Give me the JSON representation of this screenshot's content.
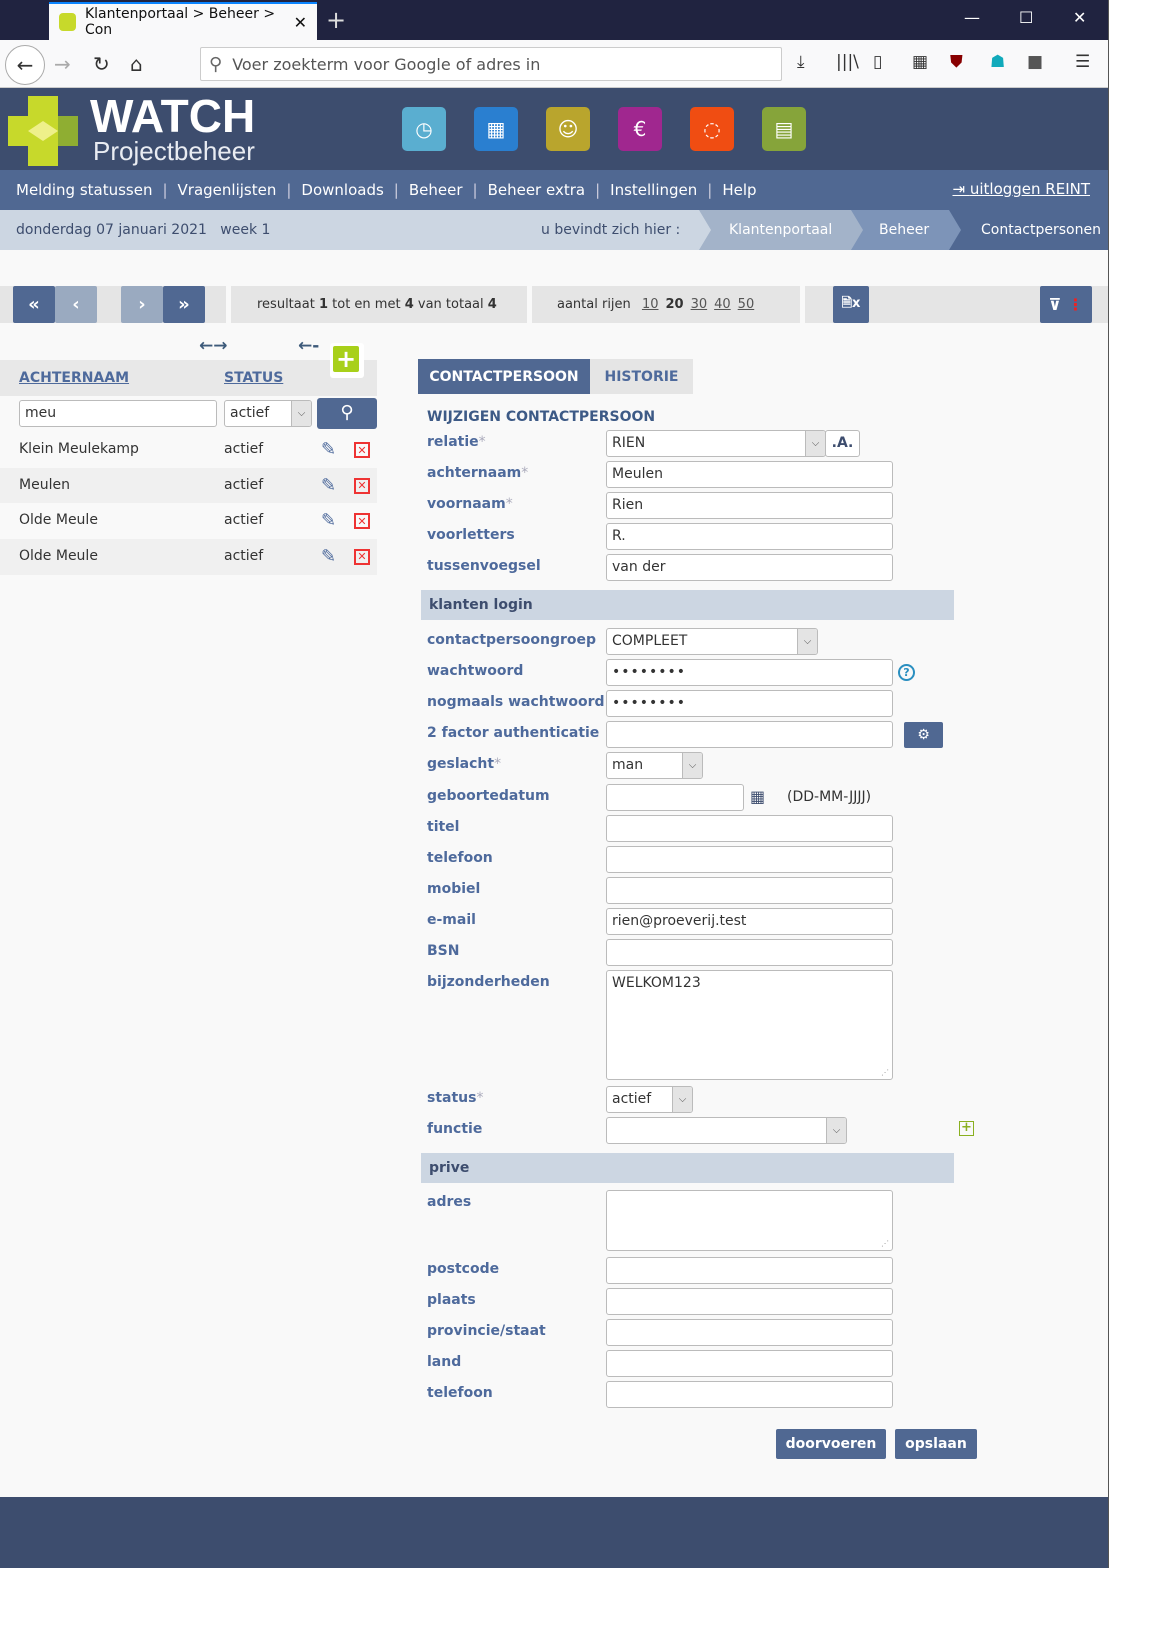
{
  "browser": {
    "tab_title": "Klantenportaal > Beheer > Con",
    "url_placeholder": "Voer zoekterm voor Google of adres in"
  },
  "brand": {
    "name": "WATCH",
    "subtitle": "Projectbeheer",
    "accent": "#c7d92b"
  },
  "app_icons": [
    {
      "name": "clock-icon",
      "color": "#5aaed0"
    },
    {
      "name": "calendar-icon",
      "color": "#2a7fd0"
    },
    {
      "name": "people-icon",
      "color": "#b9a52d"
    },
    {
      "name": "invoice-icon",
      "color": "#a0278f"
    },
    {
      "name": "chat-icon",
      "color": "#f04d12"
    },
    {
      "name": "calculator-icon",
      "color": "#86a43a"
    }
  ],
  "menu": {
    "items": [
      "Melding statussen",
      "Vragenlijsten",
      "Downloads",
      "Beheer",
      "Beheer extra",
      "Instellingen",
      "Help"
    ],
    "logout": "uitloggen REINT"
  },
  "breadcrumb": {
    "date": "donderdag 07 januari 2021",
    "week": "week 1",
    "here_label": "u bevindt zich hier :",
    "items": [
      "Klantenportaal",
      "Beheer",
      "Contactpersonen"
    ]
  },
  "pager": {
    "result_prefix": "resultaat",
    "from": "1",
    "to_label": "tot en met",
    "to": "4",
    "total_label": "van totaal",
    "total": "4",
    "rows_label": "aantal rijen",
    "row_options": [
      "10",
      "20",
      "30",
      "40",
      "50"
    ],
    "rows_selected": "20"
  },
  "list": {
    "col_name": "ACHTERNAAM",
    "col_status": "STATUS",
    "filter_name": "meu",
    "filter_status": "actief",
    "rows": [
      {
        "name": "Klein Meulekamp",
        "status": "actief"
      },
      {
        "name": "Meulen",
        "status": "actief"
      },
      {
        "name": "Olde Meule",
        "status": "actief"
      },
      {
        "name": "Olde Meule",
        "status": "actief"
      }
    ]
  },
  "form": {
    "tabs": [
      "CONTACTPERSOON",
      "HISTORIE"
    ],
    "title": "WIJZIGEN CONTACTPERSOON",
    "relatie_button": ".A.",
    "date_hint": "(DD-MM-JJJJ)",
    "fields": [
      {
        "label": "relatie",
        "required": true,
        "type": "select",
        "value": "RIEN"
      },
      {
        "label": "achternaam",
        "required": true,
        "type": "text",
        "value": "Meulen"
      },
      {
        "label": "voornaam",
        "required": true,
        "type": "text",
        "value": "Rien"
      },
      {
        "label": "voorletters",
        "type": "text",
        "value": "R."
      },
      {
        "label": "tussenvoegsel",
        "type": "text",
        "value": "van der"
      },
      {
        "section": "klanten login"
      },
      {
        "label": "contactpersoongroep",
        "type": "select",
        "value": "COMPLEET"
      },
      {
        "label": "wachtwoord",
        "type": "password",
        "value": "••••••••"
      },
      {
        "label": "nogmaals wachtwoord",
        "type": "password",
        "value": "••••••••"
      },
      {
        "label": "2 factor authenticatie",
        "type": "text",
        "value": ""
      },
      {
        "label": "geslacht",
        "required": true,
        "type": "select",
        "value": "man"
      },
      {
        "label": "geboortedatum",
        "type": "date",
        "value": ""
      },
      {
        "label": "titel",
        "type": "text",
        "value": ""
      },
      {
        "label": "telefoon",
        "type": "text",
        "value": ""
      },
      {
        "label": "mobiel",
        "type": "text",
        "value": ""
      },
      {
        "label": "e-mail",
        "type": "text",
        "value": "rien@proeverij.test"
      },
      {
        "label": "BSN",
        "type": "text",
        "value": ""
      },
      {
        "label": "bijzonderheden",
        "type": "textarea",
        "value": "WELKOM123"
      },
      {
        "label": "status",
        "required": true,
        "type": "select",
        "value": "actief"
      },
      {
        "label": "functie",
        "type": "select",
        "value": ""
      },
      {
        "section": "prive"
      },
      {
        "label": "adres",
        "type": "textarea",
        "value": ""
      },
      {
        "label": "postcode",
        "type": "text",
        "value": ""
      },
      {
        "label": "plaats",
        "type": "text",
        "value": ""
      },
      {
        "label": "provincie/staat",
        "type": "text",
        "value": ""
      },
      {
        "label": "land",
        "type": "text",
        "value": ""
      },
      {
        "label": "telefoon",
        "type": "text",
        "value": ""
      }
    ],
    "submit_label": "doorvoeren",
    "save_label": "opslaan"
  }
}
